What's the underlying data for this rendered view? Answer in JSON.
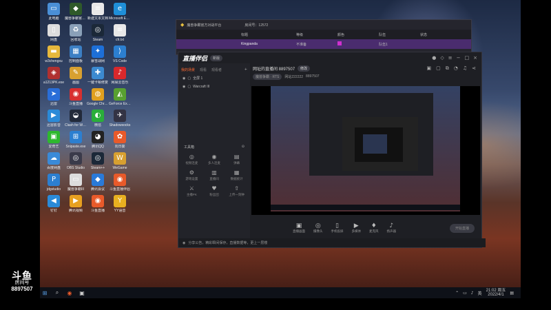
{
  "overlay": {
    "logo_title": "斗鱼",
    "logo_subtitle": "房间号",
    "room_number": "8897507"
  },
  "desktop": {
    "icons": [
      {
        "label": "此电脑",
        "icon": "computer-icon",
        "color": "#4a8fd6",
        "glyph": "▭"
      },
      {
        "label": "魔兽争霸官方对战平台",
        "icon": "warcraft-platform-icon",
        "color": "#2f5a2a",
        "glyph": "◆"
      },
      {
        "label": "新建文本文档",
        "icon": "text-document-icon",
        "color": "#e8e8e8",
        "glyph": "≡"
      },
      {
        "label": "Microsoft Edge",
        "icon": "edge-icon",
        "color": "#1f8fd8",
        "glyph": "e"
      },
      {
        "label": "网盘",
        "icon": "file-icon",
        "color": "#dddddd",
        "glyph": "▯"
      },
      {
        "label": "回收站",
        "icon": "recycle-bin-icon",
        "color": "#8aa0b8",
        "glyph": "♻"
      },
      {
        "label": "Steam",
        "icon": "steam-icon",
        "color": "#1b2838",
        "glyph": "◎"
      },
      {
        "label": "cfr.txt",
        "icon": "text-document-icon",
        "color": "#e8e8e8",
        "glyph": "≡"
      },
      {
        "label": "w3chengxu",
        "icon": "folder-icon",
        "color": "#e6b83c",
        "glyph": "▬"
      },
      {
        "label": "控制面板",
        "icon": "control-panel-icon",
        "color": "#3c7fc4",
        "glyph": "▦"
      },
      {
        "label": "暴雪战网",
        "icon": "battlenet-icon",
        "color": "#1d6fd8",
        "glyph": "✦"
      },
      {
        "label": "VS Code",
        "icon": "vscode-icon",
        "color": "#2c7fd0",
        "glyph": "⟩"
      },
      {
        "label": "a1213PK.exe",
        "icon": "exe-icon",
        "color": "#b03030",
        "glyph": "◈"
      },
      {
        "label": "画图",
        "icon": "paint-icon",
        "color": "#d8a030",
        "glyph": "✎"
      },
      {
        "label": "一键卡顿修复",
        "icon": "tool-icon",
        "color": "#3c8ad0",
        "glyph": "✚"
      },
      {
        "label": "网易云音乐",
        "icon": "netease-music-icon",
        "color": "#d8282c",
        "glyph": "♪"
      },
      {
        "label": "迅雷",
        "icon": "xunlei-icon",
        "color": "#2a6ed8",
        "glyph": "➤"
      },
      {
        "label": "斗鱼直播",
        "icon": "douyu-icon",
        "color": "#d83030",
        "glyph": "◉"
      },
      {
        "label": "Google Chrome",
        "icon": "chrome-icon",
        "color": "#e0a020",
        "glyph": "◍"
      },
      {
        "label": "GeForce Experience",
        "icon": "geforce-icon",
        "color": "#58a030",
        "glyph": "◭"
      },
      {
        "label": "迅雷影音",
        "icon": "xunlei-video-icon",
        "color": "#2a8ad8",
        "glyph": "▶"
      },
      {
        "label": "Clash for Windows",
        "icon": "clash-icon",
        "color": "#222a3a",
        "glyph": "◒"
      },
      {
        "label": "微信",
        "icon": "wechat-icon",
        "color": "#2aae3a",
        "glyph": "◐"
      },
      {
        "label": "Shadowsocks",
        "icon": "shadowsocks-icon",
        "color": "#333344",
        "glyph": "✈"
      },
      {
        "label": "爱奇艺",
        "icon": "iqiyi-icon",
        "color": "#2eb82e",
        "glyph": "▣"
      },
      {
        "label": "Snipaste.exe",
        "icon": "windows-icon",
        "color": "#2c7fd0",
        "glyph": "⊞"
      },
      {
        "label": "腾讯QQ",
        "icon": "qq-icon",
        "color": "#222222",
        "glyph": "◕"
      },
      {
        "label": "向日葵",
        "icon": "sunflower-icon",
        "color": "#e85a2a",
        "glyph": "✿"
      },
      {
        "label": "百度网盘",
        "icon": "baidu-netdisk-icon",
        "color": "#3a8ad8",
        "glyph": "☁"
      },
      {
        "label": "OBS Studio",
        "icon": "obs-icon",
        "color": "#3a3a4a",
        "glyph": "◎"
      },
      {
        "label": "Steam++",
        "icon": "steam-plus-icon",
        "color": "#1b2838",
        "glyph": "◎"
      },
      {
        "label": "WeGame",
        "icon": "wegame-icon",
        "color": "#d8a030",
        "glyph": "W"
      },
      {
        "label": "jdgstudio",
        "icon": "app-icon",
        "color": "#2c7fd0",
        "glyph": "P"
      },
      {
        "label": "魔兽争霸III",
        "icon": "warcraft-icon",
        "color": "#dddddd",
        "glyph": "▭"
      },
      {
        "label": "腾讯会议",
        "icon": "tencent-meeting-icon",
        "color": "#2a7ad8",
        "glyph": "◆"
      },
      {
        "label": "斗鱼直播伴侣",
        "icon": "douyu-companion-icon",
        "color": "#e85a2a",
        "glyph": "◉"
      },
      {
        "label": "钉钉",
        "icon": "dingtalk-icon",
        "color": "#2a8ad8",
        "glyph": "◀"
      },
      {
        "label": "腾讯视频",
        "icon": "tencent-video-icon",
        "color": "#e8a020",
        "glyph": "▶"
      },
      {
        "label": "斗鱼直播",
        "icon": "douyu-icon",
        "color": "#e85a2a",
        "glyph": "◉"
      },
      {
        "label": "YY语音",
        "icon": "yy-icon",
        "color": "#e8b020",
        "glyph": "Y"
      }
    ]
  },
  "taskbar": {
    "time": "21:02 周五",
    "date": "2022/4/1"
  },
  "back_window": {
    "title": "魔兽争霸官方对战平台",
    "room_label": "房间号：12572",
    "columns": [
      "标题",
      "等级",
      "颜色",
      "队伍",
      "状态"
    ],
    "user_name": "Kingpanda",
    "user_status": "不准备",
    "user_team": "队伍1"
  },
  "main_window": {
    "app_name": "直播伴侣",
    "version_badge": "新版",
    "left_panel": {
      "tabs": [
        "我的场景",
        "观看",
        "观看者",
        "画面设置"
      ],
      "sources": [
        "全屏 1",
        "Warcraft III"
      ],
      "tools_label": "工具箱",
      "tools": [
        {
          "label": "视频连麦",
          "icon": "video-call-icon",
          "glyph": "◎"
        },
        {
          "label": "多人连麦",
          "icon": "multi-call-icon",
          "glyph": "◉"
        },
        {
          "label": "弹幕",
          "icon": "danmaku-icon",
          "glyph": "▤"
        },
        {
          "label": "游戏设置",
          "icon": "game-settings-icon",
          "glyph": "⚙"
        },
        {
          "label": "直播间",
          "icon": "room-icon",
          "glyph": "▥"
        },
        {
          "label": "数据统计",
          "icon": "stats-icon",
          "glyph": "▦"
        },
        {
          "label": "主播PK",
          "icon": "pk-icon",
          "glyph": "⚔"
        },
        {
          "label": "粉丝团",
          "icon": "fans-icon",
          "glyph": "♥"
        },
        {
          "label": "上传一刻钟",
          "icon": "upload-icon",
          "glyph": "⇧"
        }
      ]
    },
    "right_panel": {
      "room_title": "网址的直播间 8897507",
      "edit_label": "修改",
      "category": "魔兽争霸 · RTS",
      "viewers": "网站222222",
      "room_id": "8897507",
      "bottom_tools": [
        {
          "label": "直播画面",
          "icon": "screen-icon",
          "glyph": "▣"
        },
        {
          "label": "摄像头",
          "icon": "camera-icon",
          "glyph": "◎"
        },
        {
          "label": "手机投屏",
          "icon": "phone-cast-icon",
          "glyph": "▯"
        },
        {
          "label": "多媒体",
          "icon": "media-icon",
          "glyph": "▶"
        },
        {
          "label": "麦克风",
          "icon": "microphone-icon",
          "glyph": "♦"
        },
        {
          "label": "扬声器",
          "icon": "speaker-icon",
          "glyph": "♪"
        }
      ],
      "go_live_label": "开始直播"
    },
    "status_text": "分享公告，精彩瞬间保存，直播数据等，更上一层楼"
  }
}
